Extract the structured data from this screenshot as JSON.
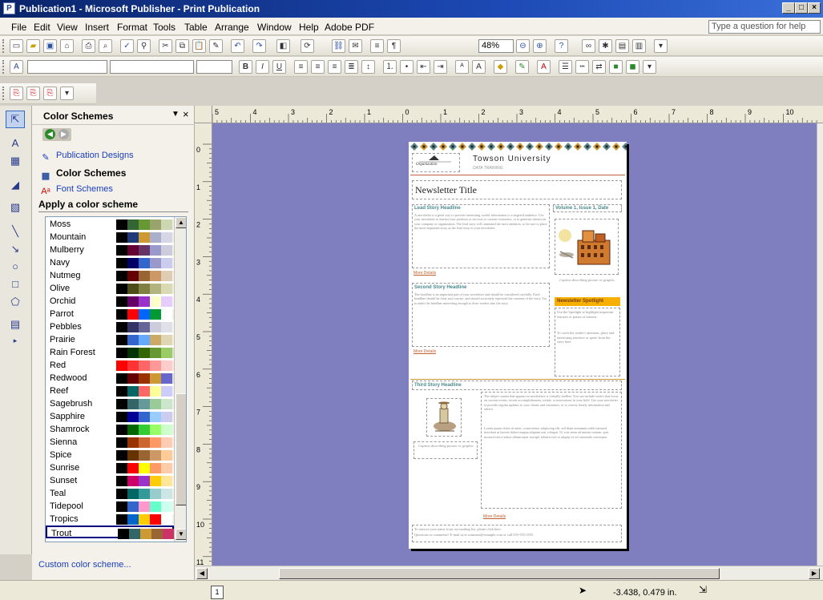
{
  "window": {
    "title": "Publication1 - Microsoft Publisher - Print Publication",
    "app_icon": "publisher-icon"
  },
  "menubar": {
    "items": [
      "File",
      "Edit",
      "View",
      "Insert",
      "Format",
      "Tools",
      "Table",
      "Arrange",
      "Window",
      "Help",
      "Adobe PDF"
    ],
    "help_placeholder": "Type a question for help"
  },
  "toolbar": {
    "zoom": "48%"
  },
  "taskpane": {
    "title": "Color Schemes",
    "links": [
      "Publication Designs",
      "Color Schemes",
      "Font Schemes"
    ],
    "apply_heading": "Apply a color scheme",
    "schemes": [
      {
        "name": "Moss",
        "colors": [
          "#000000",
          "#336633",
          "#669933",
          "#99a36b",
          "#ccd6b0",
          "#f0f0e8"
        ]
      },
      {
        "name": "Mountain",
        "colors": [
          "#000000",
          "#1f3a7a",
          "#cc9933",
          "#aab0cc",
          "#d6d6e6",
          "#f0f0f0"
        ]
      },
      {
        "name": "Mulberry",
        "colors": [
          "#000000",
          "#660033",
          "#663366",
          "#9999cc",
          "#ccccdd",
          "#f0f0f0"
        ]
      },
      {
        "name": "Navy",
        "colors": [
          "#000000",
          "#000066",
          "#3366cc",
          "#9999cc",
          "#ccccee",
          "#f0f0f0"
        ]
      },
      {
        "name": "Nutmeg",
        "colors": [
          "#000000",
          "#660000",
          "#996633",
          "#cc9966",
          "#e0ccb3",
          "#f5f0e8"
        ]
      },
      {
        "name": "Olive",
        "colors": [
          "#000000",
          "#4d4d1a",
          "#808040",
          "#b3b380",
          "#d9d9b3",
          "#f0f0e0"
        ]
      },
      {
        "name": "Orchid",
        "colors": [
          "#000000",
          "#660066",
          "#9933cc",
          "#ffffcc",
          "#e6ccff",
          "#f5f5f5"
        ]
      },
      {
        "name": "Parrot",
        "colors": [
          "#000000",
          "#ff0000",
          "#0066ff",
          "#009933",
          "#ffffff",
          "#f0f0f0"
        ]
      },
      {
        "name": "Pebbles",
        "colors": [
          "#000000",
          "#333366",
          "#666699",
          "#ccccdd",
          "#e0e0e8",
          "#f5f5f5"
        ]
      },
      {
        "name": "Prairie",
        "colors": [
          "#000000",
          "#3366cc",
          "#66aaff",
          "#ccaa66",
          "#e0d6b3",
          "#f5f0e0"
        ]
      },
      {
        "name": "Rain Forest",
        "colors": [
          "#000000",
          "#003300",
          "#336600",
          "#669933",
          "#99cc66",
          "#e0e0d0"
        ]
      },
      {
        "name": "Red",
        "colors": [
          "#ff0000",
          "#ff3333",
          "#ff6666",
          "#ff9999",
          "#ffcccc",
          "#ffe6e6"
        ]
      },
      {
        "name": "Redwood",
        "colors": [
          "#000000",
          "#660000",
          "#993300",
          "#cc9933",
          "#6666cc",
          "#e0e0e0"
        ]
      },
      {
        "name": "Reef",
        "colors": [
          "#000000",
          "#006666",
          "#ff6666",
          "#ffff99",
          "#ccccff",
          "#f0f0f0"
        ]
      },
      {
        "name": "Sagebrush",
        "colors": [
          "#000000",
          "#336666",
          "#669999",
          "#99cc99",
          "#cce6cc",
          "#f0f0f0"
        ]
      },
      {
        "name": "Sapphire",
        "colors": [
          "#000000",
          "#000099",
          "#3366cc",
          "#99ccff",
          "#ccccee",
          "#f0f0f0"
        ]
      },
      {
        "name": "Shamrock",
        "colors": [
          "#000000",
          "#006600",
          "#33cc33",
          "#99ff66",
          "#ccffcc",
          "#f0f0f0"
        ]
      },
      {
        "name": "Sienna",
        "colors": [
          "#000000",
          "#993300",
          "#cc6633",
          "#ff9966",
          "#ffccb3",
          "#f5f0e8"
        ]
      },
      {
        "name": "Spice",
        "colors": [
          "#000000",
          "#663300",
          "#996633",
          "#cc9966",
          "#ffcc99",
          "#f5f0e8"
        ]
      },
      {
        "name": "Sunrise",
        "colors": [
          "#000000",
          "#ff0000",
          "#ffff00",
          "#ff9966",
          "#ffccaa",
          "#f5f5f5"
        ]
      },
      {
        "name": "Sunset",
        "colors": [
          "#000000",
          "#cc0066",
          "#9933cc",
          "#ffcc00",
          "#ffe699",
          "#f5f5f5"
        ]
      },
      {
        "name": "Teal",
        "colors": [
          "#000000",
          "#006666",
          "#339999",
          "#99cccc",
          "#cce6e6",
          "#f0f0f0"
        ]
      },
      {
        "name": "Tidepool",
        "colors": [
          "#000000",
          "#3366cc",
          "#ff99cc",
          "#66ffcc",
          "#ccffee",
          "#f0f0f0"
        ]
      },
      {
        "name": "Tropics",
        "colors": [
          "#000000",
          "#0066cc",
          "#ffcc00",
          "#ff0000",
          "#ffffff",
          "#f0f0f0"
        ]
      },
      {
        "name": "Trout",
        "colors": [
          "#000000",
          "#336666",
          "#cc9933",
          "#996633",
          "#cc3366",
          "#f0f0f0"
        ]
      }
    ],
    "selected_scheme": "Trout",
    "custom_link": "Custom color scheme..."
  },
  "publication": {
    "org_name": "Towson University",
    "org_sub": "DATA TRAINING",
    "logo_text": "Organization",
    "newsletter_title": "Newsletter Title",
    "volume": "Volume 1, Issue 1, Date",
    "lead_headline": "Lead Story Headline",
    "lead_body": "A newsletter is a great way to provide interesting, useful information to a targeted audience. Use your newsletter to market your products or services to current customers, or to generate interest in your company or organization. The lead story will command the most attention, so be sure to place the most important story as the lead story in your newsletter.",
    "more_details": "More Details",
    "second_headline": "Second Story Headline",
    "second_body": "The headline is an important part of your newsletter and should be considered carefully. Each headline should be clear and concise, and should accurately represent the contents of the story. Try to make the headline interesting enough to draw readers into the story.",
    "caption": "Caption describing picture or graphic.",
    "spotlight": "Newsletter Spotlight",
    "spotlight_body1": "Use the Spotlight to highlight important features or points of interest.",
    "spotlight_body2": "To catch the reader's attention, place and interesting sentence or quote from the story here.",
    "third_headline": "Third Story Headline",
    "third_body1": "The subject matter that appears in newsletters is virtually endless. You can include stories that focus on current events, recent accomplishments, trends, or innovations in your field. Use your newsletter to provide regular updates to your clients and customers, or to convey timely information and advice.",
    "third_body2": "Lorem ipsum dolor sit amet, consectetuer adipiscing elit, sed diam nonummy nibh euismod tincidunt ut laoreet dolore magna aliquam erat volutpat. Ut wisi enim ad minim veniam, quis nostrud exerci tation ullamcorper suscipit lobortis nisl ut aliquip ex ea commodo consequat.",
    "footer1": "To remove your name from our mailing list, please click here.",
    "footer2": "Questions or comments? E-mail us at someone@example.com or call 555-555-5555"
  },
  "status": {
    "page": "1",
    "coords": "-3.438, 0.479 in."
  },
  "ruler": {
    "h_marks": [
      "5",
      "4",
      "3",
      "2",
      "1",
      "0",
      "1",
      "2",
      "3",
      "4",
      "5",
      "6",
      "7",
      "8",
      "9",
      "10"
    ],
    "v_marks": [
      "0",
      "1",
      "2",
      "3",
      "4",
      "5",
      "6",
      "7",
      "8",
      "9",
      "10",
      "11"
    ]
  }
}
